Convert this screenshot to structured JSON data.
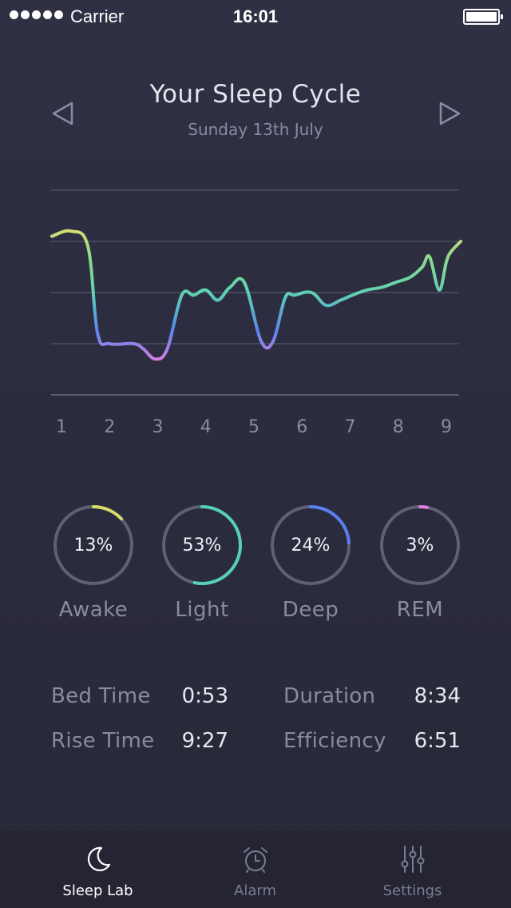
{
  "status_bar": {
    "carrier": "Carrier",
    "time": "16:01",
    "signal_bars": 5
  },
  "header": {
    "title": "Your Sleep Cycle",
    "date": "Sunday 13th July",
    "prev_icon": "triangle-left-icon",
    "next_icon": "triangle-right-icon"
  },
  "chart_data": {
    "type": "line",
    "x_ticks": [
      "1",
      "2",
      "3",
      "4",
      "5",
      "6",
      "7",
      "8",
      "9"
    ],
    "xlim": [
      1,
      9.3
    ],
    "ylim": [
      0,
      4
    ],
    "gridlines": [
      0,
      1,
      2,
      3,
      4
    ],
    "series": [
      {
        "x": [
          0.8,
          1.2,
          1.55,
          1.75,
          2.0,
          2.5,
          2.7,
          2.95,
          3.2,
          3.5,
          3.75,
          4.0,
          4.25,
          4.5,
          4.8,
          5.15,
          5.4,
          5.65,
          5.85,
          6.2,
          6.5,
          6.8,
          7.05,
          7.35,
          7.65,
          7.95,
          8.25,
          8.5,
          8.65,
          8.85,
          9.0,
          9.1,
          9.3
        ],
        "y": [
          3.1,
          3.2,
          2.9,
          1.2,
          1.0,
          1.0,
          0.9,
          0.7,
          0.9,
          1.95,
          1.95,
          2.05,
          1.85,
          2.1,
          2.2,
          1.05,
          1.05,
          1.9,
          1.95,
          2.0,
          1.75,
          1.85,
          1.95,
          2.05,
          2.1,
          2.2,
          2.3,
          2.5,
          2.7,
          2.05,
          2.6,
          2.8,
          3.0
        ]
      }
    ],
    "gradient_colors": [
      "#d8e06a",
      "#5ed0b0",
      "#5b86f0",
      "#d87be0"
    ]
  },
  "stages": [
    {
      "value": "13%",
      "label": "Awake",
      "fraction": 0.13,
      "color": "#d8dd6a"
    },
    {
      "value": "53%",
      "label": "Light",
      "fraction": 0.53,
      "color": "#55d0b5"
    },
    {
      "value": "24%",
      "label": "Deep",
      "fraction": 0.24,
      "color": "#5b7ff2"
    },
    {
      "value": "3%",
      "label": "REM",
      "fraction": 0.03,
      "color": "#e07be0"
    }
  ],
  "stats": {
    "bed_time": {
      "label": "Bed Time",
      "value": "0:53"
    },
    "rise_time": {
      "label": "Rise Time",
      "value": "9:27"
    },
    "duration": {
      "label": "Duration",
      "value": "8:34"
    },
    "efficiency": {
      "label": "Efficiency",
      "value": "6:51"
    }
  },
  "tabs": [
    {
      "label": "Sleep Lab",
      "icon": "moon-icon",
      "active": true
    },
    {
      "label": "Alarm",
      "icon": "alarm-clock-icon",
      "active": false
    },
    {
      "label": "Settings",
      "icon": "sliders-icon",
      "active": false
    }
  ]
}
